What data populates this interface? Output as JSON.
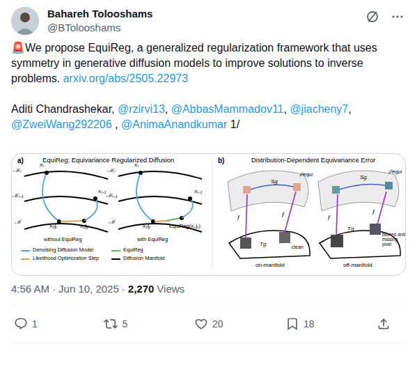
{
  "author": {
    "name": "Bahareh Tolooshams",
    "handle": "@BTolooshams"
  },
  "tweet": {
    "paragraphs": [
      [
        {
          "text": "🚨We propose EquiReg, a generalized regularization framework that uses symmetry in generative diffusion models to improve solutions to inverse problems. ",
          "kind": "text"
        },
        {
          "text": "arxiv.org/abs/2505.22973",
          "kind": "link"
        }
      ],
      [
        {
          "text": "Aditi Chandrashekar, ",
          "kind": "text"
        },
        {
          "text": "@rzirvi13",
          "kind": "mention"
        },
        {
          "text": ", ",
          "kind": "text"
        },
        {
          "text": "@AbbasMammadov11",
          "kind": "mention"
        },
        {
          "text": ", ",
          "kind": "text"
        },
        {
          "text": "@jiacheny7",
          "kind": "mention"
        },
        {
          "text": ", ",
          "kind": "text"
        },
        {
          "text": "@ZweiWang292206",
          "kind": "mention"
        },
        {
          "text": " , ",
          "kind": "text"
        },
        {
          "text": "@AnimaAnandkumar",
          "kind": "mention"
        },
        {
          "text": " 1/",
          "kind": "text"
        }
      ]
    ]
  },
  "figure": {
    "a": {
      "label": "a)",
      "title": "EquiReg: Equivariance Regularized Diffusion",
      "manifolds": [
        "ℳₜ",
        "ℳₜ₋₁",
        "ℳ"
      ],
      "points": [
        "xₜ",
        "xₜ₋₁",
        "x₀|ₜ",
        "x₀|ᵧ"
      ],
      "equireg_point": "EquiReg(x₀|ᵧ)",
      "captions": [
        "without EquiReg",
        "with EquiReg"
      ],
      "legend": [
        {
          "text": "Denoising Diffusion Model",
          "color": "#4aa8e0"
        },
        {
          "text": "Likelihood Optimization Step",
          "color": "#f39c3c"
        },
        {
          "text": "EquiReg",
          "color": "#5cb84a"
        },
        {
          "text": "Diffusion Manifold",
          "color": "#000000"
        }
      ]
    },
    "b": {
      "label": "b)",
      "title": "Distribution-Dependent Equivariance Error",
      "map": "f",
      "group": "Sg",
      "transform": "Tg",
      "loss": "ℒequi",
      "clean": "clean",
      "corrupted": "blurred and missing pixel",
      "regions": [
        "on-manifold",
        "off-manifold"
      ]
    }
  },
  "meta": {
    "time": "4:56 AM",
    "sep": "·",
    "date": "Jun 10, 2025",
    "views": "2,270",
    "views_label": "Views"
  },
  "actions": [
    {
      "kind": "reply",
      "count": "1"
    },
    {
      "kind": "retweet",
      "count": "5"
    },
    {
      "kind": "like",
      "count": "20"
    },
    {
      "kind": "bookmark",
      "count": "18"
    },
    {
      "kind": "share"
    }
  ]
}
